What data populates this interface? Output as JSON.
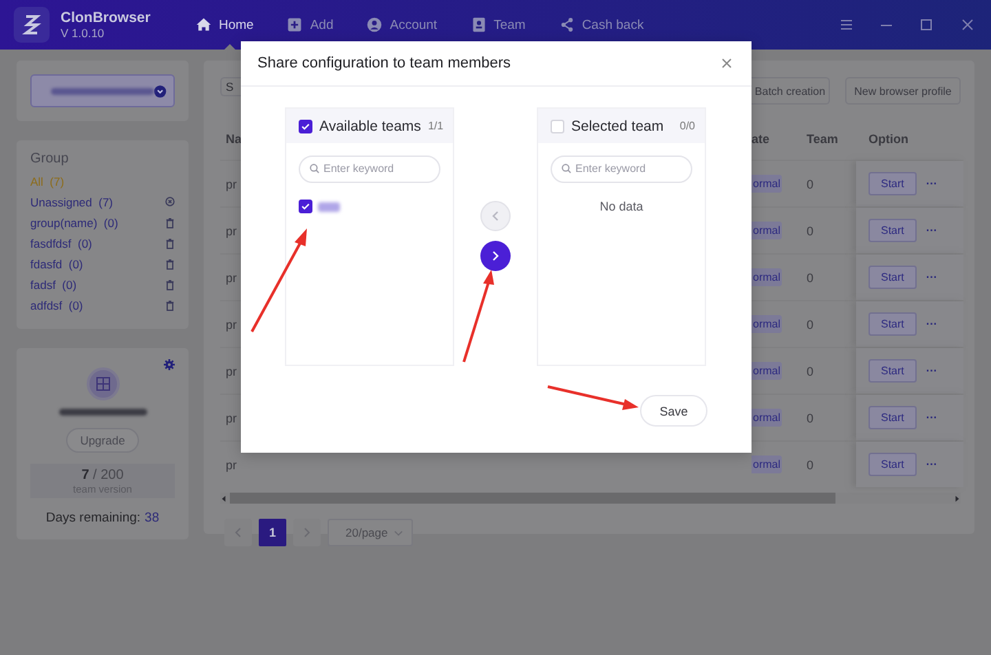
{
  "app": {
    "name": "ClonBrowser",
    "version": "V 1.0.10"
  },
  "nav": [
    {
      "label": "Home",
      "kind": "home",
      "selected": true
    },
    {
      "label": "Add",
      "kind": "add",
      "selected": false
    },
    {
      "label": "Account",
      "kind": "account",
      "selected": false
    },
    {
      "label": "Team",
      "kind": "team",
      "selected": false
    },
    {
      "label": "Cash back",
      "kind": "share",
      "selected": false
    }
  ],
  "sidebar": {
    "title": "Group",
    "groups": [
      {
        "label": "All  (7)",
        "kind": "all",
        "selected": true
      },
      {
        "label": "Unassigned  (7)",
        "kind": "fixed",
        "selected": false
      },
      {
        "label": "group(name)  (0)",
        "kind": "custom",
        "selected": false
      },
      {
        "label": "fasdfdsf  (0)",
        "kind": "custom",
        "selected": false
      },
      {
        "label": "fdasfd  (0)",
        "kind": "custom",
        "selected": false
      },
      {
        "label": "fadsf  (0)",
        "kind": "custom",
        "selected": false
      },
      {
        "label": "adfdsf  (0)",
        "kind": "custom",
        "selected": false
      }
    ]
  },
  "account": {
    "upgrade": "Upgrade",
    "usage": "**7** / 200",
    "plan": "team version",
    "days_label": "Days remaining:",
    "days": "38"
  },
  "toolbar": {
    "search_placeholder": "S",
    "buttons": [
      "Batch creation",
      "New browser profile"
    ]
  },
  "table": {
    "columns": [
      "Na",
      "ate",
      "Team",
      "Option"
    ],
    "rows": [
      {
        "name": "pr",
        "status": "ormal",
        "team": "0",
        "action": "Start",
        "more": "···"
      },
      {
        "name": "pr",
        "status": "ormal",
        "team": "0",
        "action": "Start",
        "more": "···"
      },
      {
        "name": "pr",
        "status": "ormal",
        "team": "0",
        "action": "Start",
        "more": "···"
      },
      {
        "name": "pr",
        "status": "ormal",
        "team": "0",
        "action": "Start",
        "more": "···"
      },
      {
        "name": "pr",
        "status": "ormal",
        "team": "0",
        "action": "Start",
        "more": "···"
      },
      {
        "name": "pr",
        "status": "ormal",
        "team": "0",
        "action": "Start",
        "more": "···"
      },
      {
        "name": "pr",
        "status": "ormal",
        "team": "0",
        "action": "Start",
        "more": "···"
      }
    ]
  },
  "pagination": {
    "pages": [
      {
        "label": "1",
        "selected": true
      }
    ],
    "page_size": "20/page"
  },
  "dialog": {
    "title": "Share configuration to team members",
    "lists": [
      {
        "title": "Available teams",
        "count": "1/1",
        "checked": true,
        "placeholder": "Enter keyword",
        "items": [
          {
            "checked": true
          }
        ]
      },
      {
        "title": "Selected team",
        "count": "0/0",
        "checked": false,
        "placeholder": "Enter keyword",
        "empty": "No data"
      }
    ],
    "transfer": [
      {
        "kind": "left",
        "disabled": true
      },
      {
        "kind": "right",
        "disabled": false
      }
    ],
    "save": "Save"
  }
}
